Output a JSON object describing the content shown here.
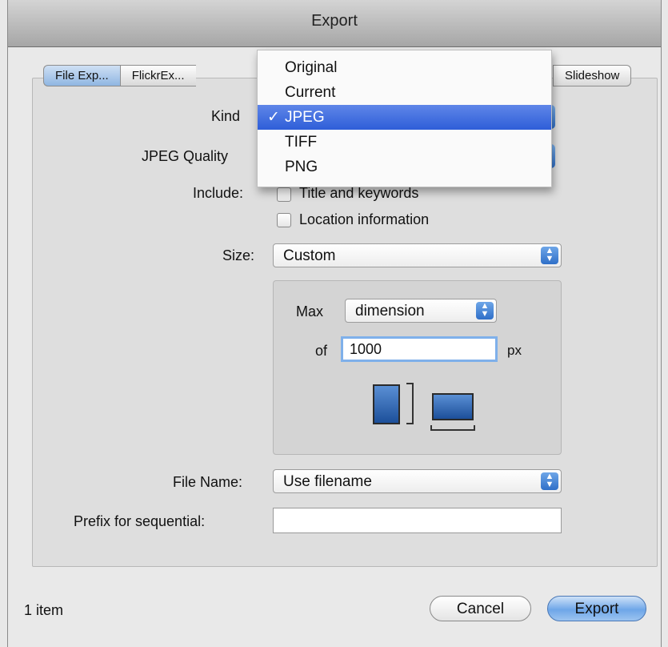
{
  "window": {
    "title": "Export"
  },
  "tabs": [
    {
      "label": "File Exp..."
    },
    {
      "label": "FlickrEx..."
    }
  ],
  "tab_last": {
    "label": "Slideshow"
  },
  "kind": {
    "label": "Kind",
    "selected": "JPEG"
  },
  "jpeg_quality": {
    "label": "JPEG Quality"
  },
  "include": {
    "label": "Include:",
    "options": [
      {
        "label": "Title and keywords",
        "checked": false
      },
      {
        "label": "Location information",
        "checked": false
      }
    ]
  },
  "size": {
    "label": "Size:",
    "value": "Custom",
    "max_label": "Max",
    "max_value": "dimension",
    "of_label": "of",
    "of_value": "1000",
    "unit": "px"
  },
  "file_name": {
    "label": "File Name:",
    "value": "Use filename"
  },
  "prefix": {
    "label": "Prefix for sequential:",
    "value": ""
  },
  "footer": {
    "item_count": "1 item",
    "cancel": "Cancel",
    "export": "Export"
  },
  "dropdown": {
    "items": [
      "Original",
      "Current",
      "JPEG",
      "TIFF",
      "PNG"
    ],
    "selected_index": 2,
    "check_mark": "✓"
  },
  "colors": {
    "accent": "#2e5ed8",
    "focus_ring": "#7fb0ea"
  }
}
